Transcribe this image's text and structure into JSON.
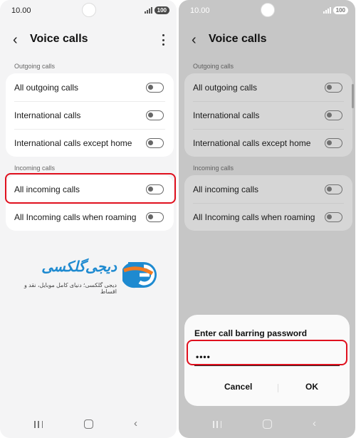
{
  "status_bar": {
    "time": "10.00",
    "battery": "100"
  },
  "screen": {
    "title": "Voice calls",
    "outgoing_section": "Outgoing calls",
    "outgoing_items": [
      {
        "label": "All outgoing calls",
        "enabled": false
      },
      {
        "label": "International calls",
        "enabled": false
      },
      {
        "label": "International calls except home",
        "enabled": false
      }
    ],
    "incoming_section": "Incoming calls",
    "incoming_items": [
      {
        "label": "All incoming calls",
        "enabled": false
      },
      {
        "label": "All Incoming calls when roaming",
        "enabled": false
      }
    ]
  },
  "watermark": {
    "wordmark": "دیجی‌گلکسی",
    "tagline": "دیجی گلکسی؛ دنیای کامل موبایل، نقد و اقساط"
  },
  "dialog": {
    "title": "Enter call barring password",
    "password_value": "••••",
    "cancel_label": "Cancel",
    "ok_label": "OK"
  },
  "colors": {
    "highlight": "#e0101e",
    "brand_blue": "#1e8ad0",
    "brand_orange": "#f27a21"
  },
  "icons": [
    "back-icon",
    "more-options-icon",
    "toggle-icon",
    "recents-icon",
    "home-icon",
    "nav-back-icon",
    "signal-icon"
  ]
}
